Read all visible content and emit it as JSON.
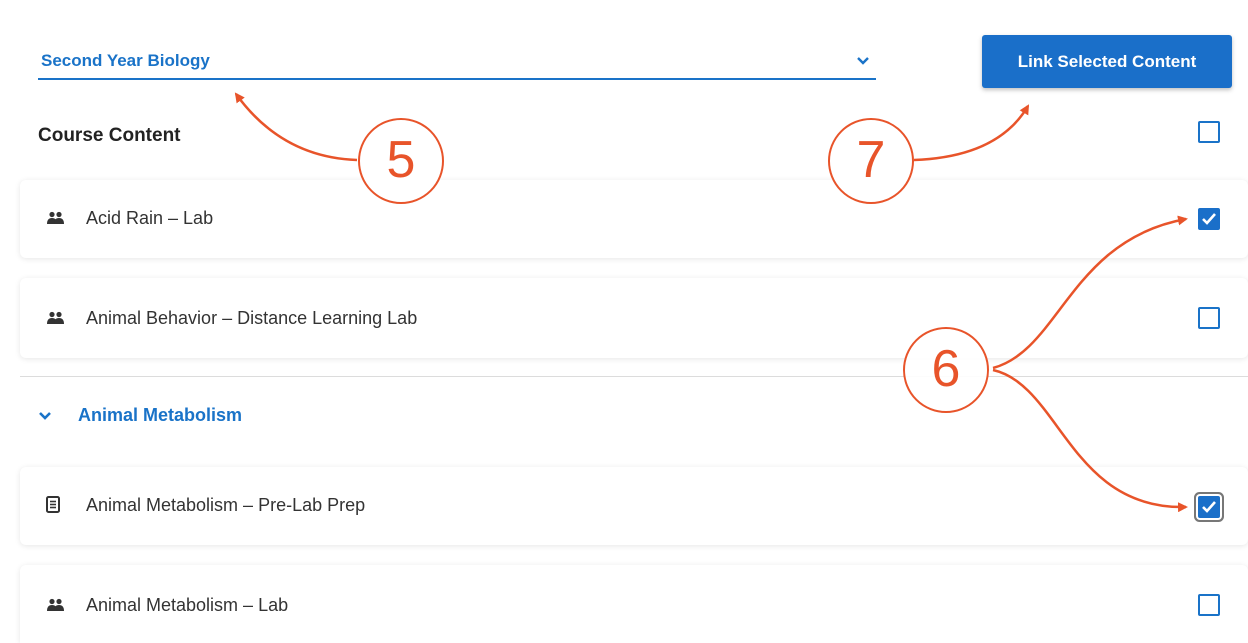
{
  "course_select": {
    "value": "Second Year Biology",
    "icon": "chevron-down-icon"
  },
  "link_button": {
    "label": "Link Selected Content"
  },
  "section": {
    "title": "Course Content",
    "select_all_checked": false
  },
  "items": [
    {
      "label": "Acid Rain – Lab",
      "icon": "group-icon",
      "checked": true
    },
    {
      "label": "Animal Behavior – Distance Learning Lab",
      "icon": "group-icon",
      "checked": false
    }
  ],
  "group": {
    "label": "Animal Metabolism",
    "icon": "chevron-down-icon",
    "items": [
      {
        "label": "Animal Metabolism – Pre-Lab Prep",
        "icon": "document-icon",
        "checked": true
      },
      {
        "label": "Animal Metabolism – Lab",
        "icon": "group-icon",
        "checked": false
      }
    ]
  },
  "callouts": [
    "5",
    "6",
    "7"
  ],
  "colors": {
    "accent": "#1a73c8",
    "button": "#1a6fc9",
    "callout": "#e8542a"
  }
}
